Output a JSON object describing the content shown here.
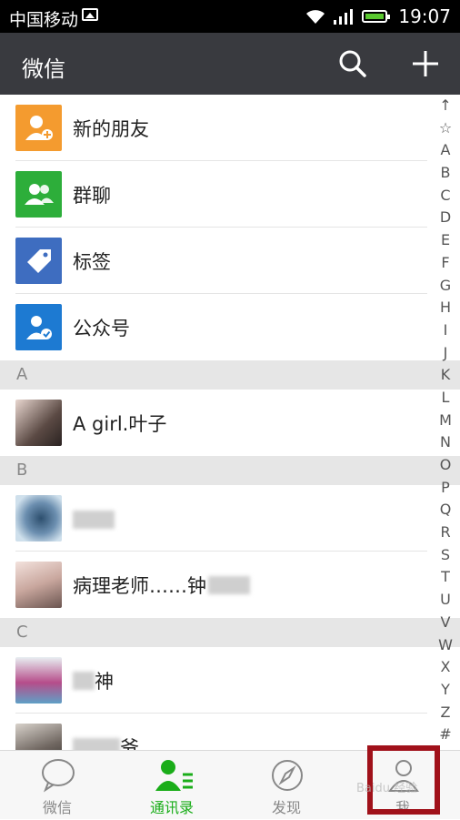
{
  "status": {
    "carrier": "中国移动",
    "time": "19:07"
  },
  "header": {
    "title": "微信"
  },
  "features": [
    {
      "label": "新的朋友",
      "icon": "add-friend-icon",
      "color": "#f49b2f"
    },
    {
      "label": "群聊",
      "icon": "group-chat-icon",
      "color": "#2dae3a"
    },
    {
      "label": "标签",
      "icon": "tag-icon",
      "color": "#3e6dc0"
    },
    {
      "label": "公众号",
      "icon": "official-account-icon",
      "color": "#1d7ad2"
    }
  ],
  "sections": {
    "a": "A",
    "b": "B",
    "c": "C"
  },
  "contacts": {
    "c1": "A girl.叶子",
    "c2": "",
    "c3": "病理老师……钟",
    "c4": "神",
    "c5": "爷"
  },
  "index": [
    "↑",
    "☆",
    "A",
    "B",
    "C",
    "D",
    "E",
    "F",
    "G",
    "H",
    "I",
    "J",
    "K",
    "L",
    "M",
    "N",
    "O",
    "P",
    "Q",
    "R",
    "S",
    "T",
    "U",
    "V",
    "W",
    "X",
    "Y",
    "Z",
    "#"
  ],
  "tabs": {
    "chats": "微信",
    "contacts": "通讯录",
    "discover": "发现",
    "me": "我"
  },
  "colors": {
    "accent": "#1aad19",
    "titlebar": "#393a3f",
    "highlight": "#a0111a"
  },
  "watermark": "Baidu 经验"
}
